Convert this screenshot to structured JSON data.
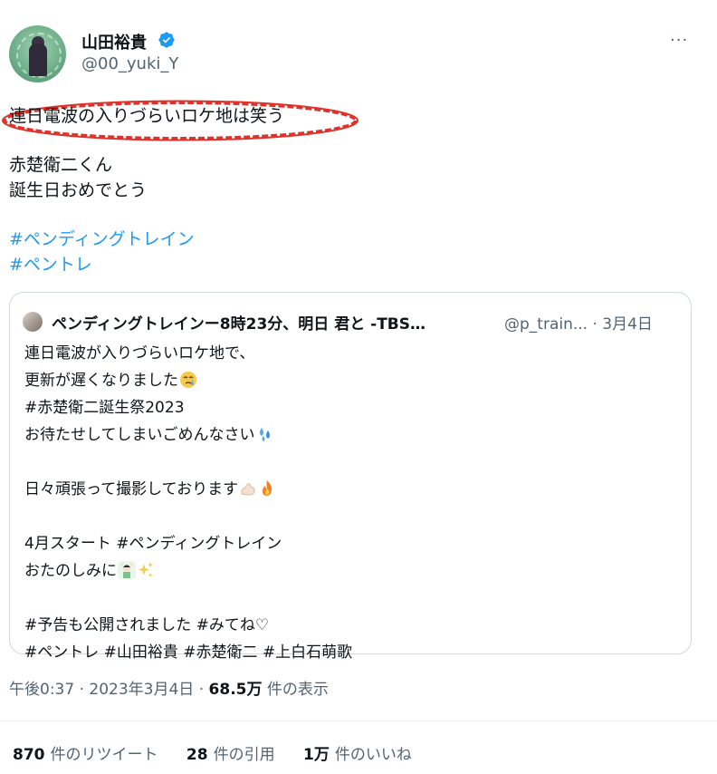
{
  "author": {
    "name": "山田裕貴",
    "handle": "@00_yuki_Y",
    "more": "···"
  },
  "tweet": {
    "line1": "連日電波の入りづらいロケ地は笑う",
    "line2": "赤楚衛二くん",
    "line3": "誕生日おめでとう",
    "hashtag1": "#ペンディングトレイン",
    "hashtag2": "#ペントレ"
  },
  "quote": {
    "name": "ペンディングトレインー8時23分、明日 君と -TBS…",
    "handle_date": "@p_train... · 3月4日",
    "lines": [
      "連日電波が入りづらいロケ地で、",
      "更新が遅くなりました",
      "#赤楚衛二誕生祭2023",
      "お待たせしてしまいごめんなさい",
      "",
      "日々頑張って撮影しております",
      "",
      "4月スタート #ペンディングトレイン",
      "おたのしみに",
      "",
      "#予告も公開されました #みてね♡",
      "#ペントレ #山田裕貴 #赤楚衛二 #上白石萌歌"
    ]
  },
  "meta": {
    "time": "午後0:37",
    "date": "2023年3月4日",
    "views_count": "68.5万",
    "views_label": "件の表示",
    "separator": "·"
  },
  "stats": {
    "retweets_count": "870",
    "retweets_label": "件のリツイート",
    "quotes_count": "28",
    "quotes_label": "件の引用",
    "likes_count": "1万",
    "likes_label": "件のいいね"
  },
  "colors": {
    "link": "#1d9bf0",
    "secondary": "#536471",
    "highlight": "#e0322b",
    "verified": "#1d9bf0"
  }
}
